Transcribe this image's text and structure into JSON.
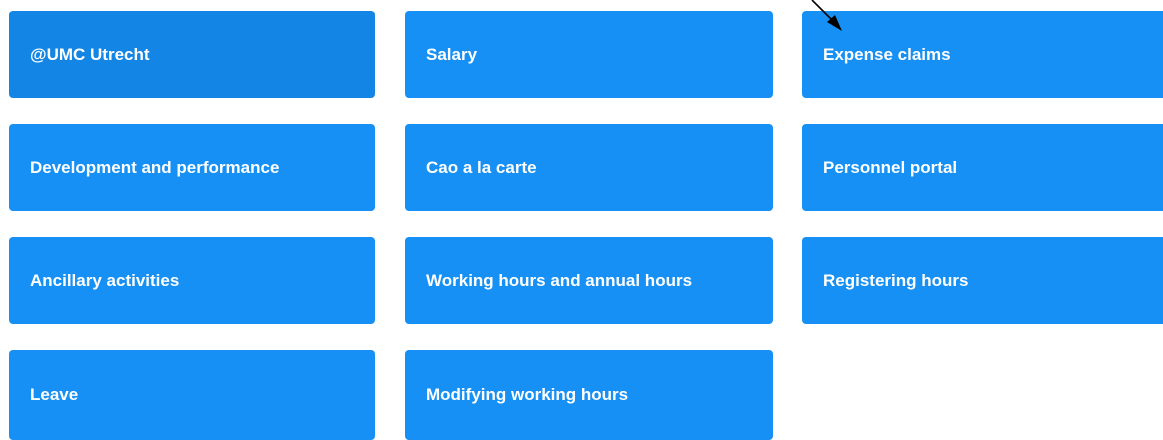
{
  "tiles": [
    {
      "label": "@UMC Utrecht",
      "active": true
    },
    {
      "label": "Salary"
    },
    {
      "label": "Expense claims"
    },
    {
      "label": "Development and performance"
    },
    {
      "label": "Cao a la carte"
    },
    {
      "label": "Personnel portal"
    },
    {
      "label": "Ancillary activities"
    },
    {
      "label": "Working hours and annual hours"
    },
    {
      "label": "Registering hours"
    },
    {
      "label": "Leave"
    },
    {
      "label": "Modifying working hours"
    }
  ],
  "colors": {
    "tile": "#1690f5",
    "tile_active": "#1385e4",
    "text": "#ffffff"
  },
  "cursor_icon": "mouse-pointer-arrow-icon"
}
